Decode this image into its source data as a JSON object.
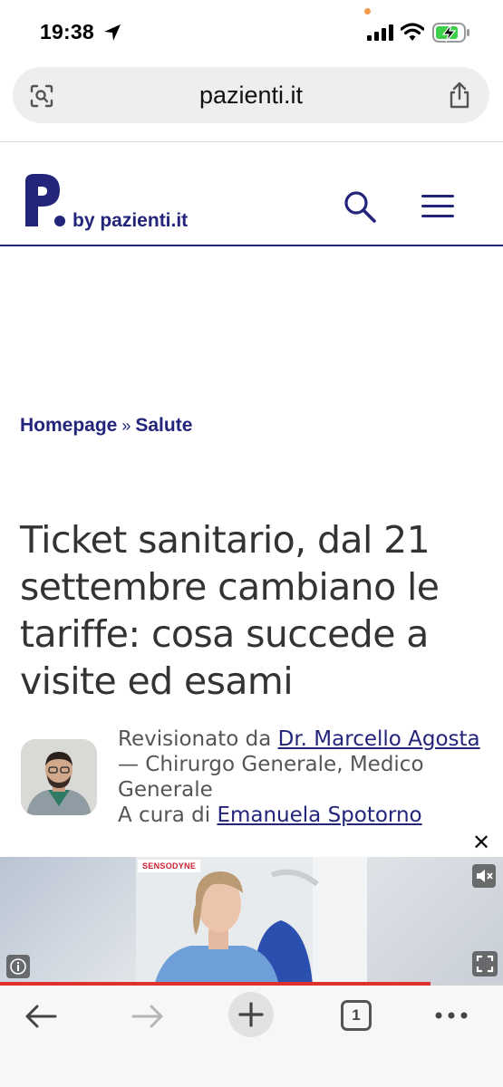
{
  "status_bar": {
    "time": "19:38"
  },
  "url_bar": {
    "domain": "pazienti.it"
  },
  "site": {
    "logo_letter": "P",
    "logo_byline": "by pazienti.it"
  },
  "breadcrumb": {
    "home": "Homepage",
    "separator": "»",
    "section": "Salute"
  },
  "article": {
    "title": "Ticket sanitario, dal 21 settembre cambiano le tariffe: cosa succede a visite ed esami",
    "reviewed_prefix": "Revisionato da",
    "reviewer_name": "Dr. Marcello Agosta",
    "reviewer_role": "— Chirurgo Generale, Medico Generale",
    "author_prefix": "A cura di",
    "author_name": "Emanuela Spotorno"
  },
  "ad": {
    "brand": "SENSODYNE",
    "close_label": "✕",
    "progress": 0.855
  },
  "toolbar": {
    "tab_count": "1"
  },
  "colors": {
    "brand": "#23257a",
    "ad_progress": "#e0302b"
  }
}
